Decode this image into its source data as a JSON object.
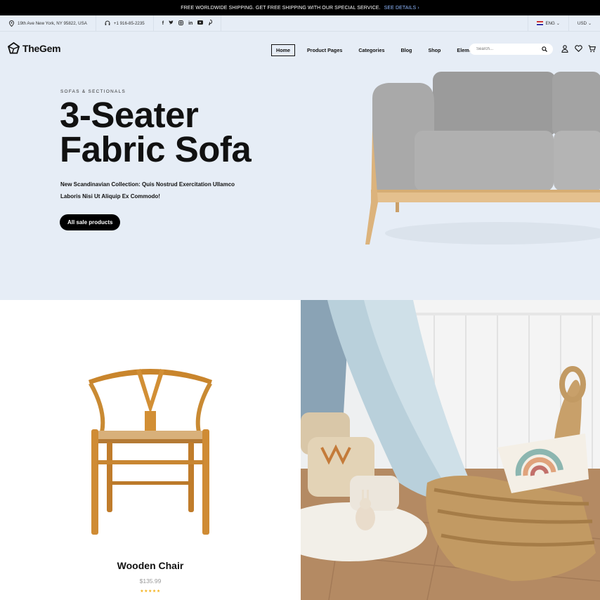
{
  "announcement": {
    "text": "FREE WORLDWIDE SHIPPING. GET FREE SHIPPING WITH OUR SPECIAL SERVICE.",
    "link": "SEE DETAILS ›"
  },
  "info_bar": {
    "address": "19th Ave New York, NY 95822, USA",
    "phone": "+1 916-85-2235",
    "socials": [
      "facebook-icon",
      "twitter-icon",
      "instagram-icon",
      "linkedin-icon",
      "youtube-icon",
      "pinterest-icon"
    ],
    "language": "ENG",
    "currency": "USD"
  },
  "header": {
    "logo": "TheGem",
    "nav": [
      "Home",
      "Product Pages",
      "Categories",
      "Blog",
      "Shop",
      "Elements"
    ],
    "active_nav": "Home",
    "search_placeholder": "Search...",
    "icons": [
      "user-icon",
      "heart-icon",
      "cart-icon"
    ]
  },
  "hero": {
    "kicker": "SOFAS & SECTIONALS",
    "title_line1": "3-Seater",
    "title_line2": "Fabric Sofa",
    "subtitle_line1": "New Scandinavian Collection: Quis Nostrud Exercitation Ullamco",
    "subtitle_line2": "Laboris Nisi Ut Aliquip Ex Commodo!",
    "cta": "All sale products",
    "bg_color": "#e6edf6"
  },
  "product": {
    "name": "Wooden Chair",
    "price": "$135.99",
    "rating": 5,
    "stars": "★★★★★"
  }
}
